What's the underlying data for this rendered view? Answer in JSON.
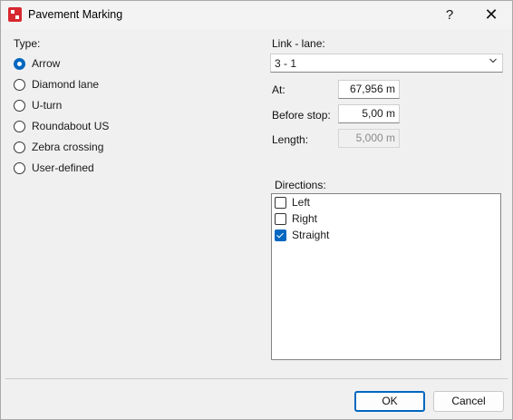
{
  "window": {
    "title": "Pavement Marking",
    "help_label": "?",
    "close_label": "✕"
  },
  "type_group": {
    "label": "Type:",
    "options": [
      "Arrow",
      "Diamond lane",
      "U-turn",
      "Roundabout US",
      "Zebra crossing",
      "User-defined"
    ],
    "selected": "Arrow"
  },
  "link_lane": {
    "label": "Link - lane:",
    "value": "3 - 1"
  },
  "at": {
    "label": "At:",
    "value": "67,956 m"
  },
  "before_stop": {
    "label": "Before stop:",
    "value": "5,00 m"
  },
  "length": {
    "label": "Length:",
    "value": "5,000 m"
  },
  "directions": {
    "label": "Directions:",
    "items": [
      {
        "label": "Left",
        "checked": false
      },
      {
        "label": "Right",
        "checked": false
      },
      {
        "label": "Straight",
        "checked": true
      }
    ]
  },
  "buttons": {
    "ok": "OK",
    "cancel": "Cancel"
  },
  "colors": {
    "accent": "#0067c0",
    "app_icon": "#d7282f"
  }
}
